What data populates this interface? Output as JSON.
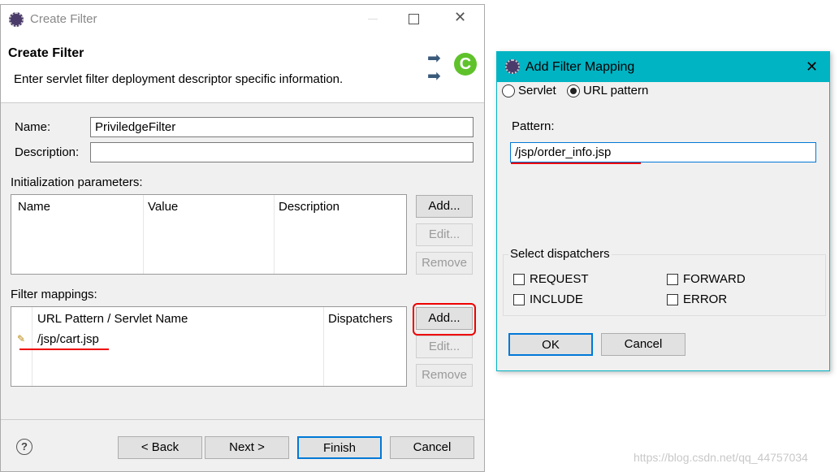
{
  "create_filter": {
    "window_title": "Create Filter",
    "header_title": "Create Filter",
    "header_desc": "Enter servlet filter deployment descriptor specific information.",
    "name_label": "Name:",
    "name_value": "PriviledgeFilter",
    "description_label": "Description:",
    "description_value": "",
    "init_params_label": "Initialization parameters:",
    "init_columns": [
      "Name",
      "Value",
      "Description"
    ],
    "init_buttons": {
      "add": "Add...",
      "edit": "Edit...",
      "remove": "Remove"
    },
    "mappings_label": "Filter mappings:",
    "mapping_columns": [
      "URL Pattern / Servlet Name",
      "Dispatchers"
    ],
    "mapping_rows": [
      {
        "pattern": "/jsp/cart.jsp",
        "dispatchers": ""
      }
    ],
    "mapping_buttons": {
      "add": "Add...",
      "edit": "Edit...",
      "remove": "Remove"
    },
    "footer": {
      "back": "< Back",
      "next": "Next >",
      "finish": "Finish",
      "cancel": "Cancel"
    }
  },
  "add_mapping": {
    "title": "Add Filter Mapping",
    "radio_servlet": "Servlet",
    "radio_url": "URL pattern",
    "selected": "URL pattern",
    "pattern_label": "Pattern:",
    "pattern_value": "/jsp/order_info.jsp",
    "dispatchers_label": "Select dispatchers",
    "dispatchers": [
      {
        "label": "REQUEST",
        "checked": false
      },
      {
        "label": "FORWARD",
        "checked": false
      },
      {
        "label": "INCLUDE",
        "checked": false
      },
      {
        "label": "ERROR",
        "checked": false
      }
    ],
    "ok": "OK",
    "cancel": "Cancel"
  },
  "watermark": "https://blog.csdn.net/qq_44757034",
  "colors": {
    "dialog_titlebar": "#00b4c4",
    "annotation": "#e00000",
    "focus": "#0078d7"
  }
}
